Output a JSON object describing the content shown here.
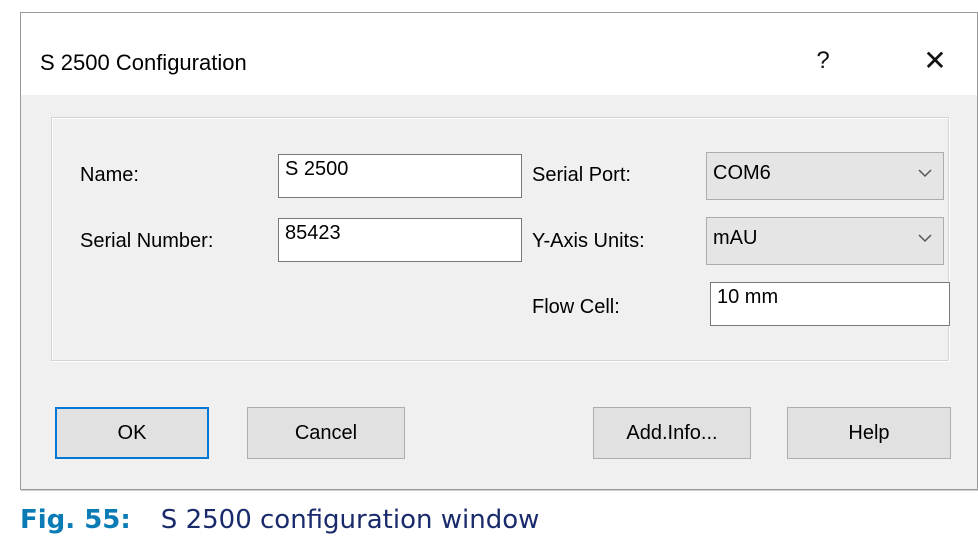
{
  "window": {
    "title": "S 2500 Configuration",
    "help_glyph": "?",
    "close_glyph": "✕"
  },
  "fields": {
    "name": {
      "label": "Name:",
      "value": "S 2500"
    },
    "serial_number": {
      "label": "Serial Number:",
      "value": "85423"
    },
    "serial_port": {
      "label": "Serial Port:",
      "selected": "COM6"
    },
    "y_axis_units": {
      "label": "Y-Axis Units:",
      "selected": "mAU"
    },
    "flow_cell": {
      "label": "Flow Cell:",
      "value": "10 mm"
    }
  },
  "buttons": {
    "ok": "OK",
    "cancel": "Cancel",
    "add_info": "Add.Info...",
    "help": "Help"
  },
  "caption": {
    "figure": "Fig. 55:",
    "text": "S 2500 configuration window"
  },
  "colors": {
    "accent": "#0078d7",
    "figure_label": "#0a7bb5",
    "caption_text": "#1a2b6b"
  }
}
